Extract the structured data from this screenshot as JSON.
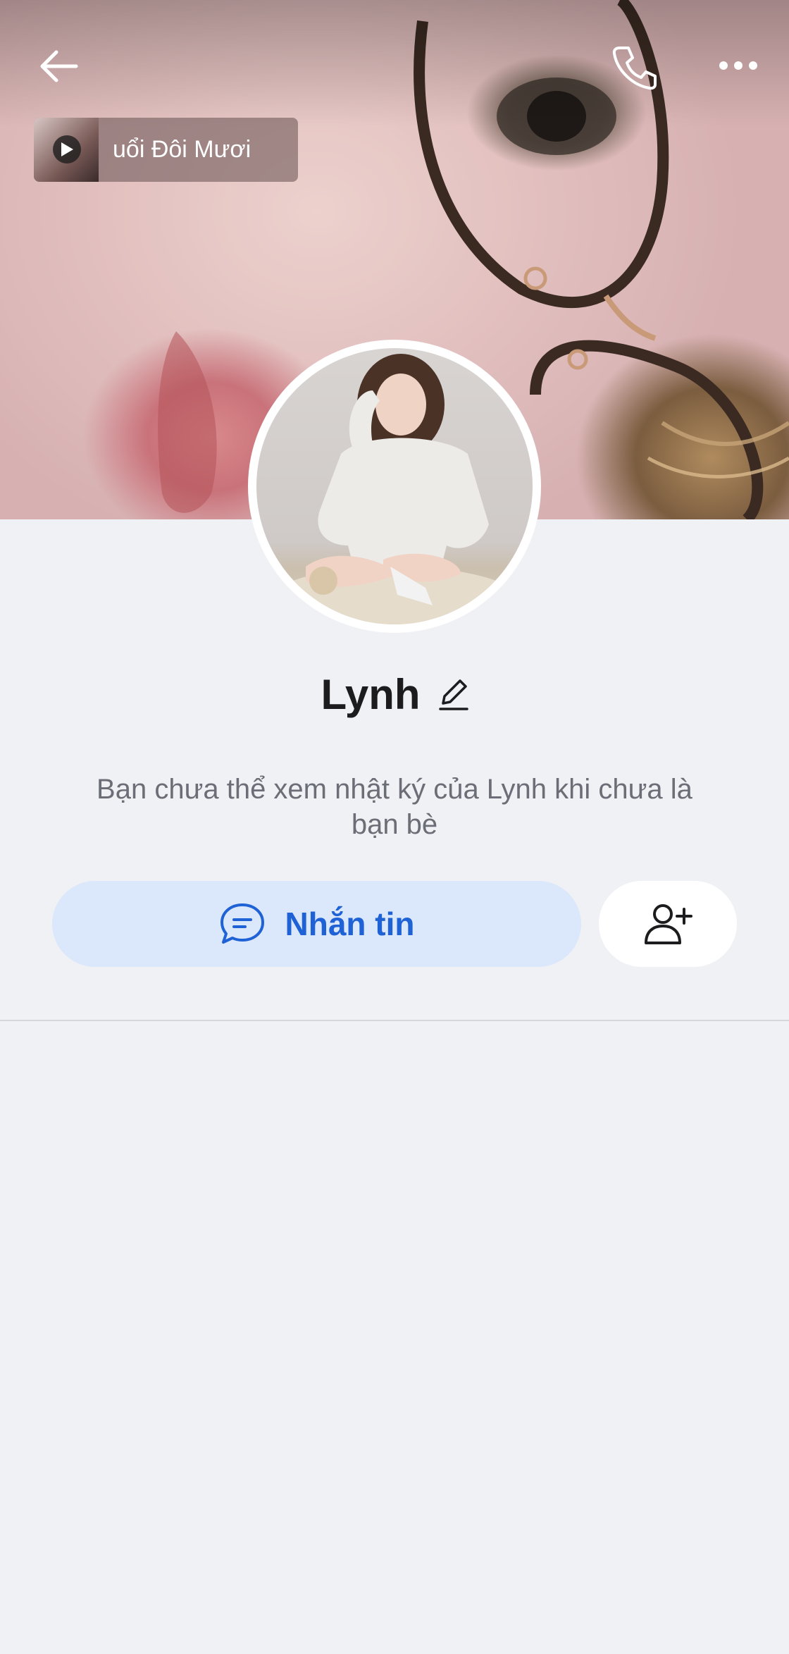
{
  "header": {
    "back_icon": "arrow-left-icon",
    "call_icon": "phone-icon",
    "more_icon": "more-horizontal-icon"
  },
  "music": {
    "title": "uổi Đôi Mươi",
    "play_icon": "play-icon"
  },
  "profile": {
    "name": "Lynh",
    "edit_icon": "pencil-icon",
    "notice": "Bạn chưa thể xem nhật ký của Lynh khi chưa là bạn bè"
  },
  "actions": {
    "message_label": "Nhắn tin",
    "message_icon": "chat-bubble-icon",
    "add_friend_icon": "add-friend-icon"
  },
  "colors": {
    "accent": "#1f62d6",
    "message_button_bg": "#dbe7fb",
    "page_bg": "#f0f1f5"
  }
}
